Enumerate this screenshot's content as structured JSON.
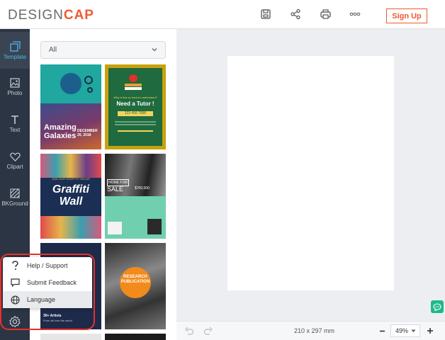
{
  "brand": {
    "logo_light": "DESIGN",
    "logo_bold": "CAP",
    "accent": "#ef5a32"
  },
  "toolbar": {
    "save_icon": "save-icon",
    "share_icon": "share-icon",
    "print_icon": "print-icon",
    "more_icon": "more-icon",
    "signup_label": "Sign Up"
  },
  "sidebar": {
    "items": [
      {
        "label": "Template",
        "icon": "template-icon",
        "active": true
      },
      {
        "label": "Photo",
        "icon": "photo-icon"
      },
      {
        "label": "Text",
        "icon": "text-icon"
      },
      {
        "label": "Clipart",
        "icon": "heart-icon"
      },
      {
        "label": "BKGround",
        "icon": "background-icon"
      }
    ],
    "settings_icon": "gear-icon"
  },
  "panel": {
    "filter_value": "All",
    "templates": [
      {
        "title_line1": "Amazing",
        "title_line2": "Galaxies",
        "date": "DECEMBER 20, 2018",
        "bg": "#1fa7a0"
      },
      {
        "title": "Need a Tutor !",
        "subtitle": "Why is this so hard to understand?",
        "phone": "123 456 7890",
        "bg": "#c8a20e"
      },
      {
        "title_line1": "Graffiti",
        "title_line2": "Wall",
        "top_text": "JOIN OUR GRAFFITI GROUP",
        "bg": "#1b2f55"
      },
      {
        "title_line1": "HOME FOR",
        "title_line2": "SALE",
        "price": "$700,000",
        "bg": "#2a2a2a"
      },
      {
        "title": "30+ Artists",
        "subtitle": "From all over the world",
        "bg": "#1d2a4a"
      },
      {
        "title_line1": "RESEARCH",
        "title_line2": "PUBLICATION",
        "bg": "#444444"
      }
    ]
  },
  "popup": {
    "items": [
      {
        "label": "Help / Support",
        "icon": "question-icon"
      },
      {
        "label": "Submit Feedback",
        "icon": "feedback-icon"
      },
      {
        "label": "Language",
        "icon": "globe-icon"
      }
    ]
  },
  "canvas": {
    "size_label": "210 x 297 mm",
    "zoom": "49%",
    "undo_icon": "undo-icon",
    "redo_icon": "redo-icon"
  }
}
